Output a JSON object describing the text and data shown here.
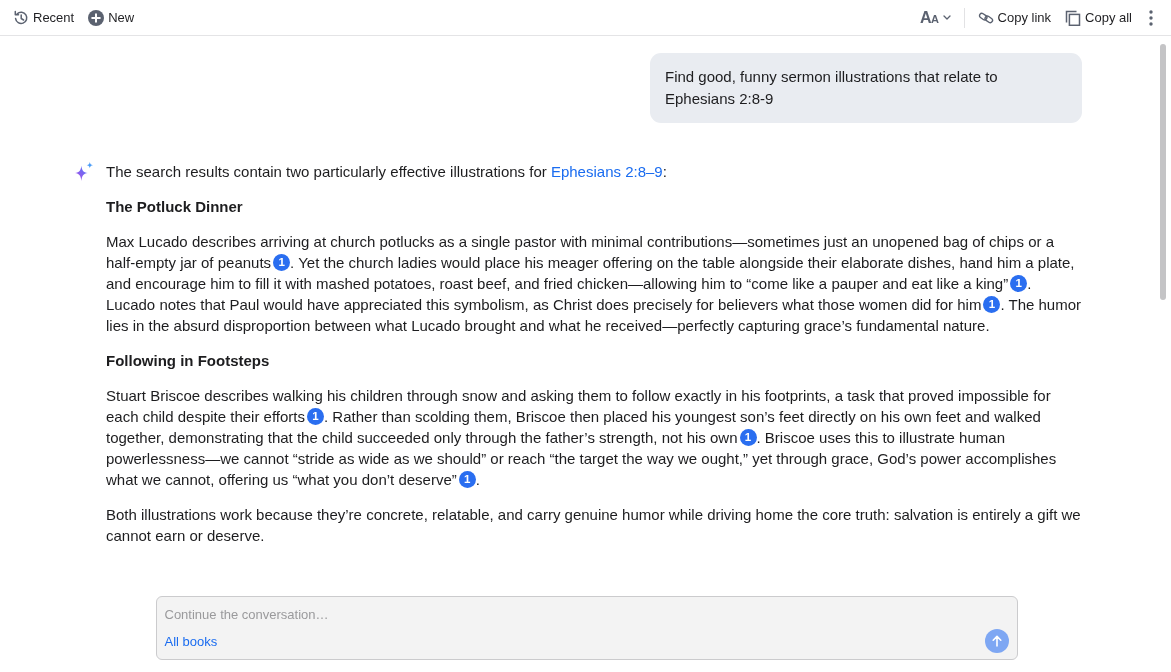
{
  "toolbar": {
    "left": [
      {
        "kind": "recent",
        "label": "Recent"
      },
      {
        "kind": "new",
        "label": "New"
      }
    ],
    "right": [
      {
        "kind": "font_size",
        "label": "AA"
      },
      {
        "kind": "copy_link",
        "label": "Copy link"
      },
      {
        "kind": "copy_all",
        "label": "Copy all"
      },
      {
        "kind": "more"
      }
    ]
  },
  "conversation": {
    "user_message": "Find good, funny sermon illustrations that relate to Ephesians 2:8-9",
    "answer": [
      {
        "kind": "paragraph",
        "segments": [
          {
            "kind": "text",
            "text": "The search results contain two particularly effective illustrations for "
          },
          {
            "kind": "link",
            "text": "Ephesians 2:8–9"
          },
          {
            "kind": "text",
            "text": ":"
          }
        ]
      },
      {
        "kind": "heading",
        "text": "The Potluck Dinner"
      },
      {
        "kind": "paragraph",
        "segments": [
          {
            "kind": "text",
            "text": "Max Lucado describes arriving at church potlucks as a single pastor with minimal contributions—sometimes just an unopened bag of chips or a half-empty jar of peanuts"
          },
          {
            "kind": "citation",
            "text": "1"
          },
          {
            "kind": "text",
            "text": ". Yet the church ladies would place his meager offering on the table alongside their elaborate dishes, hand him a plate, and encourage him to fill it with mashed potatoes, roast beef, and fried chicken—allowing him to “come like a pauper and eat like a king”"
          },
          {
            "kind": "citation",
            "text": "1"
          },
          {
            "kind": "text",
            "text": ". Lucado notes that Paul would have appreciated this symbolism, as Christ does precisely for believers what those women did for him"
          },
          {
            "kind": "citation",
            "text": "1"
          },
          {
            "kind": "text",
            "text": ". The humor lies in the absurd disproportion between what Lucado brought and what he received—perfectly capturing grace’s fundamental nature."
          }
        ]
      },
      {
        "kind": "heading",
        "text": "Following in Footsteps"
      },
      {
        "kind": "paragraph",
        "segments": [
          {
            "kind": "text",
            "text": "Stuart Briscoe describes walking his children through snow and asking them to follow exactly in his footprints, a task that proved impossible for each child despite their efforts"
          },
          {
            "kind": "citation",
            "text": "1"
          },
          {
            "kind": "text",
            "text": ". Rather than scolding them, Briscoe then placed his youngest son’s feet directly on his own feet and walked together, demonstrating that the child succeeded only through the father’s strength, not his own"
          },
          {
            "kind": "citation",
            "text": "1"
          },
          {
            "kind": "text",
            "text": ". Briscoe uses this to illustrate human powerlessness—we cannot “stride as wide as we should” or reach “the target the way we ought,” yet through grace, God’s power accomplishes what we cannot, offering us “what you don’t deserve”"
          },
          {
            "kind": "citation",
            "text": "1"
          },
          {
            "kind": "text",
            "text": "."
          }
        ]
      },
      {
        "kind": "paragraph",
        "segments": [
          {
            "kind": "text",
            "text": "Both illustrations work because they’re concrete, relatable, and carry genuine humor while driving home the core truth: salvation is entirely a gift we cannot earn or deserve."
          }
        ]
      }
    ]
  },
  "composer": {
    "placeholder": "Continue the conversation…",
    "scope_link": "All books",
    "send_button": {
      "disabled": true
    }
  }
}
